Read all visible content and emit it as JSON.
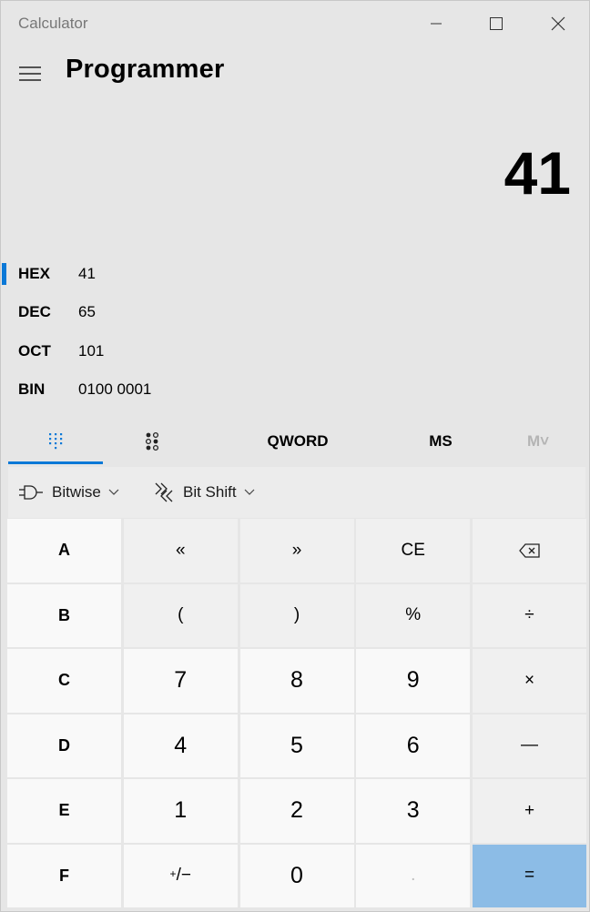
{
  "window": {
    "title": "Calculator"
  },
  "header": {
    "mode": "Programmer"
  },
  "display": {
    "value": "41"
  },
  "radix": [
    {
      "label": "HEX",
      "value": "41",
      "selected": true
    },
    {
      "label": "DEC",
      "value": "65"
    },
    {
      "label": "OCT",
      "value": "101"
    },
    {
      "label": "BIN",
      "value": "0100 0001"
    }
  ],
  "tabs": {
    "word_size": "QWORD",
    "memory_store": "MS",
    "memory_dropdown": "M˅"
  },
  "ops": {
    "bitwise": "Bitwise",
    "bitshift": "Bit Shift"
  },
  "keys": {
    "a": "A",
    "lshift": "«",
    "rshift": "»",
    "ce": "CE",
    "b": "B",
    "lparen": "(",
    "rparen": ")",
    "percent": "%",
    "divide": "÷",
    "c": "C",
    "n7": "7",
    "n8": "8",
    "n9": "9",
    "multiply": "×",
    "d": "D",
    "n4": "4",
    "n5": "5",
    "n6": "6",
    "minus": "—",
    "e": "E",
    "n1": "1",
    "n2": "2",
    "n3": "3",
    "plus": "+",
    "f": "F",
    "negate_plus": "+",
    "negate_minus": "/−",
    "n0": "0",
    "decimal": ".",
    "equals": "="
  },
  "icons": {
    "minimize": "minimize-icon",
    "maximize": "maximize-icon",
    "close": "close-icon",
    "menu": "hamburger-icon",
    "keypad": "keypad-icon",
    "bit_toggle": "bit-toggle-icon",
    "bitwise": "logic-gate-icon",
    "bitshift": "bit-shift-icon",
    "backspace": "backspace-icon",
    "chevron": "chevron-down-icon"
  },
  "colors": {
    "accent": "#0a78d7",
    "equals_bg": "#8cbce6",
    "window_bg": "#e6e6e6",
    "key_light": "#f9f9f9",
    "key_dark": "#f0f0f0"
  }
}
